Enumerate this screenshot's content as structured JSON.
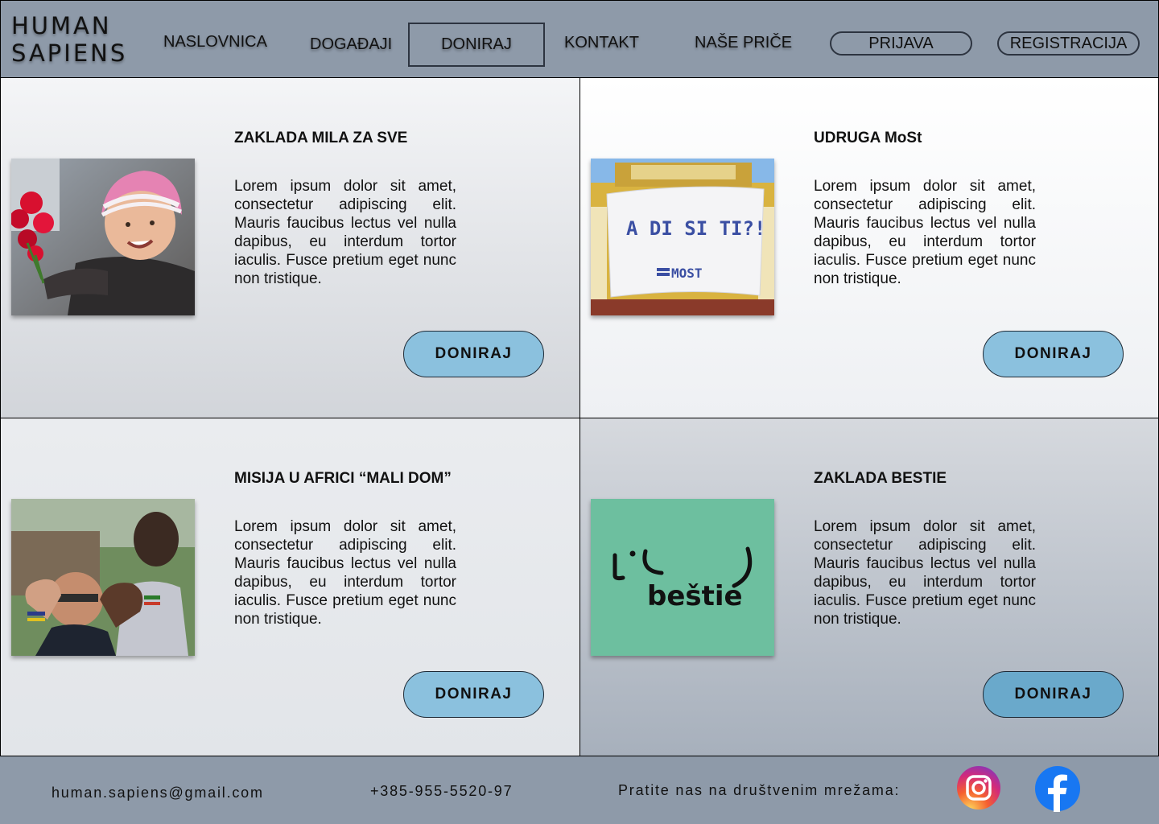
{
  "brand": {
    "line1": "HUMAN",
    "line2": "SAPIENS"
  },
  "nav": {
    "home": "NASLOVNICA",
    "events": "DOGAĐAJI",
    "donate": "DONIRAJ",
    "contact": "KONTAKT",
    "stories": "NAŠE PRIČE",
    "login": "PRIJAVA",
    "register": "REGISTRACIJA"
  },
  "cards": [
    {
      "title": "ZAKLADA MILA ZA SVE",
      "text": "Lorem ipsum dolor sit amet, consectetur adipiscing elit. Mauris faucibus lectus vel nulla dapibus, eu interdum tortor iaculis. Fusce pretium eget nunc non tristique.",
      "button": "DONIRAJ",
      "image": "child-with-flowers-photo"
    },
    {
      "title": "UDRUGA MoSt",
      "text": "Lorem ipsum dolor sit amet, consectetur adipiscing elit. Mauris faucibus lectus vel nulla dapibus, eu interdum tortor iaculis. Fusce pretium eget nunc non tristique.",
      "button": "DONIRAJ",
      "image": "banner-photo",
      "banner_text": "A DI SI TI?!",
      "banner_logo": "MOST"
    },
    {
      "title": "MISIJA U AFRICI “MALI DOM”",
      "text": "Lorem ipsum dolor sit amet, consectetur adipiscing elit. Mauris faucibus lectus vel nulla dapibus, eu interdum tortor iaculis. Fusce pretium eget nunc non tristique.",
      "button": "DONIRAJ",
      "image": "heart-hands-photo"
    },
    {
      "title": "ZAKLADA BESTIE",
      "text": "Lorem ipsum dolor sit amet, consectetur adipiscing elit. Mauris faucibus lectus vel nulla dapibus, eu interdum tortor iaculis. Fusce pretium eget nunc non tristique.",
      "button": "DONIRAJ",
      "image": "bestie-logo",
      "logo_text": "beštie"
    }
  ],
  "footer": {
    "email": "human.sapiens@gmail.com",
    "phone": "+385-955-5520-97",
    "social_label": "Pratite nas na društvenim mrežama:",
    "icons": [
      "instagram-icon",
      "facebook-icon"
    ]
  },
  "colors": {
    "header_bg": "#8e9aa9",
    "button_bg": "#8bc1de",
    "bestie_bg": "#6dbf9f",
    "facebook_blue": "#1877f2"
  }
}
